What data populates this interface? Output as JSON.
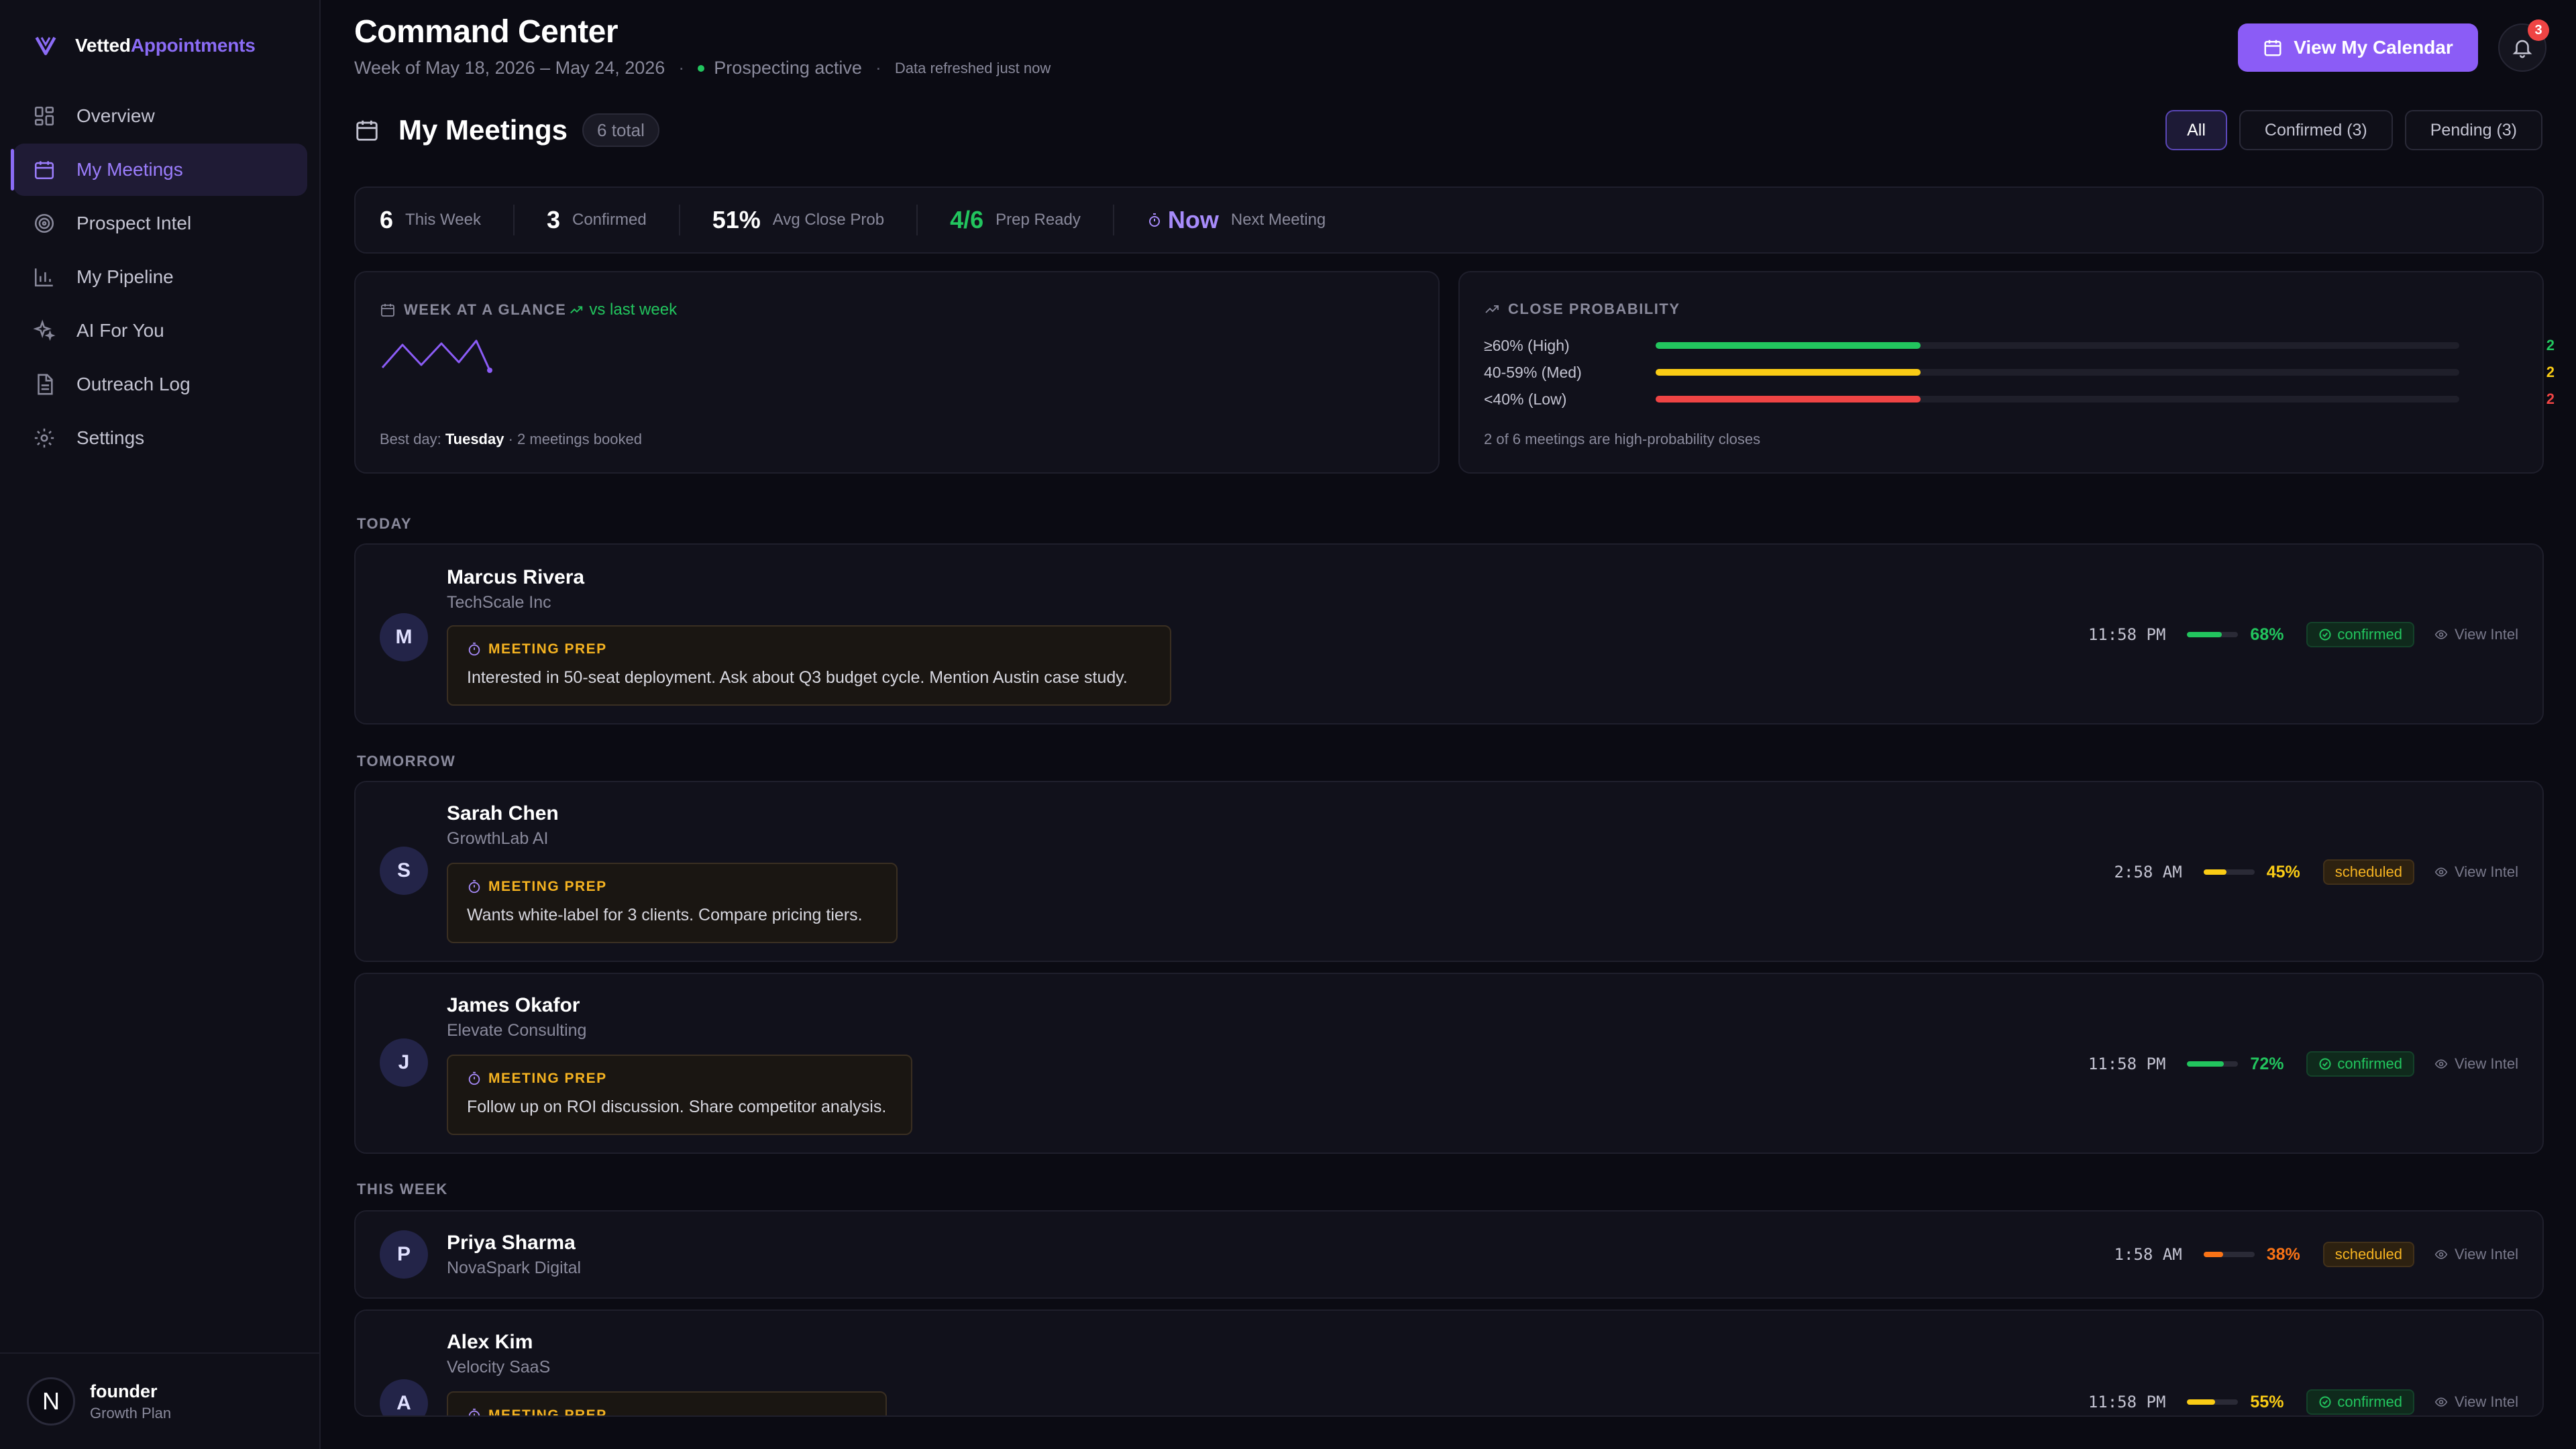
{
  "brand": {
    "part1": "Vetted",
    "part2": "Appointments"
  },
  "nav": [
    {
      "label": "Overview",
      "icon": "grid-icon",
      "active": false
    },
    {
      "label": "My Meetings",
      "icon": "calendar-icon",
      "active": true
    },
    {
      "label": "Prospect Intel",
      "icon": "target-icon",
      "active": false
    },
    {
      "label": "My Pipeline",
      "icon": "bar-chart-icon",
      "active": false
    },
    {
      "label": "AI For You",
      "icon": "sparkles-icon",
      "active": false
    },
    {
      "label": "Outreach Log",
      "icon": "document-icon",
      "active": false
    },
    {
      "label": "Settings",
      "icon": "gear-icon",
      "active": false
    }
  ],
  "user": {
    "initial": "N",
    "name": "founder",
    "plan": "Growth Plan"
  },
  "header": {
    "title": "Command Center",
    "week": "Week of May 18, 2026 – May 24, 2026",
    "status": "Prospecting active",
    "refresh": "Data refreshed just now",
    "calendar_button": "View My Calendar",
    "notification_count": "3"
  },
  "meetings_header": {
    "title": "My Meetings",
    "total": "6 total",
    "filters": [
      "All",
      "Confirmed (3)",
      "Pending (3)"
    ],
    "active_filter": "All"
  },
  "stats": [
    {
      "value": "6",
      "label": "This Week",
      "color": "#ffffff"
    },
    {
      "value": "3",
      "label": "Confirmed",
      "color": "#ffffff"
    },
    {
      "value": "51%",
      "label": "Avg Close Prob",
      "color": "#ffffff"
    },
    {
      "value": "4/6",
      "label": "Prep Ready",
      "color": "#22c55e"
    },
    {
      "value": "Now",
      "label": "Next Meeting",
      "color": "#a78bfa"
    }
  ],
  "week_glance": {
    "title": "WEEK AT A GLANCE",
    "trend": "vs last week",
    "best_day_prefix": "Best day:",
    "best_day": "Tuesday",
    "best_day_suffix": "· 2 meetings booked"
  },
  "close_probability": {
    "title": "CLOSE PROBABILITY",
    "rows": [
      {
        "label": "≥60% (High)",
        "count": "2",
        "fraction": 0.33,
        "color": "#22c55e"
      },
      {
        "label": "40-59% (Med)",
        "count": "2",
        "fraction": 0.33,
        "color": "#facc15"
      },
      {
        "label": "<40% (Low)",
        "count": "2",
        "fraction": 0.33,
        "color": "#ef4444"
      }
    ],
    "footer": "2 of 6 meetings are high-probability closes"
  },
  "sections": {
    "today": "TODAY",
    "tomorrow": "TOMORROW",
    "this_week": "THIS WEEK"
  },
  "prep_label": "MEETING PREP",
  "view_intel": "View Intel",
  "meetings": [
    {
      "initial": "M",
      "name": "Marcus Rivera",
      "company": "TechScale Inc",
      "prep": "Interested in 50-seat deployment. Ask about Q3 budget cycle. Mention Austin case study.",
      "time": "11:58 PM",
      "prob": "68%",
      "prob_value": 0.68,
      "prob_color": "#22c55e",
      "status": "confirmed"
    },
    {
      "initial": "S",
      "name": "Sarah Chen",
      "company": "GrowthLab AI",
      "prep": "Wants white-label for 3 clients. Compare pricing tiers.",
      "time": "2:58 AM",
      "prob": "45%",
      "prob_value": 0.45,
      "prob_color": "#facc15",
      "status": "scheduled"
    },
    {
      "initial": "J",
      "name": "James Okafor",
      "company": "Elevate Consulting",
      "prep": "Follow up on ROI discussion. Share competitor analysis.",
      "time": "11:58 PM",
      "prob": "72%",
      "prob_value": 0.72,
      "prob_color": "#22c55e",
      "status": "confirmed"
    },
    {
      "initial": "P",
      "name": "Priya Sharma",
      "company": "NovaSpark Digital",
      "prep": "",
      "time": "1:58 AM",
      "prob": "38%",
      "prob_value": 0.38,
      "prob_color": "#f97316",
      "status": "scheduled"
    },
    {
      "initial": "A",
      "name": "Alex Kim",
      "company": "Velocity SaaS",
      "prep": "",
      "time": "11:58 PM",
      "prob": "55%",
      "prob_value": 0.55,
      "prob_color": "#facc15",
      "status": "confirmed"
    }
  ],
  "colors": {
    "accent": "#8b5cf6",
    "confirmed": "#22c55e",
    "scheduled": "#f5b321"
  }
}
